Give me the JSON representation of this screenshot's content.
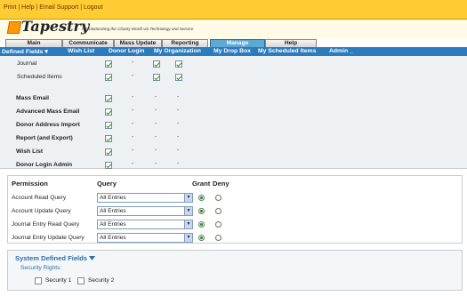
{
  "top_links": {
    "print": "Print",
    "help": "Help",
    "email_support": "Email Support",
    "logout": "Logout",
    "sep": "|"
  },
  "brand": {
    "name": "Tapestry",
    "tagline": "Revolutionizing the Charity World via Technology and Service"
  },
  "tabs": [
    {
      "label": "Main"
    },
    {
      "label": "Communicate"
    },
    {
      "label": "Mass Update"
    },
    {
      "label": "Reporting"
    },
    {
      "label": "Manage"
    },
    {
      "label": "Help"
    }
  ],
  "subnav": [
    "Defined Fields",
    "Wish List",
    "Donor Login",
    "My Organization",
    "My Drop Box",
    "My Scheduled Items",
    "Admin"
  ],
  "subnav_dropdown_marker": "▾",
  "subnav_admin_marker": "_",
  "feature_rows": [
    {
      "label": "Journal",
      "bold": false,
      "cells": [
        "check",
        "-",
        "check",
        "check"
      ]
    },
    {
      "label": "Scheduled Items",
      "bold": false,
      "cells": [
        "check",
        "-",
        "check",
        "check"
      ]
    },
    {
      "label": "Mass Email",
      "bold": true,
      "cells": [
        "check",
        "-",
        "-",
        "-"
      ]
    },
    {
      "label": "Advanced Mass Email",
      "bold": true,
      "cells": [
        "check",
        "-",
        "-",
        "-"
      ]
    },
    {
      "label": "Donor Address Import",
      "bold": true,
      "cells": [
        "check",
        "-",
        "-",
        "-"
      ]
    },
    {
      "label": "Report (and Export)",
      "bold": true,
      "cells": [
        "check",
        "-",
        "-",
        "-"
      ]
    },
    {
      "label": "Wish List",
      "bold": true,
      "cells": [
        "check",
        "-",
        "-",
        "-"
      ]
    },
    {
      "label": "Donor Login Admin",
      "bold": true,
      "cells": [
        "check",
        "-",
        "-",
        "-"
      ]
    }
  ],
  "permissions": {
    "headers": {
      "permission": "Permission",
      "query": "Query",
      "grant": "Grant",
      "deny": "Deny"
    },
    "rows": [
      {
        "label": "Account Read Query",
        "query": "All Entries",
        "grant": true
      },
      {
        "label": "Account Update Query",
        "query": "All Entries",
        "grant": true
      },
      {
        "label": "Journal Entry Read Query",
        "query": "All Entries",
        "grant": true
      },
      {
        "label": "Journal Entry Update Query",
        "query": "All Entries",
        "grant": true
      }
    ]
  },
  "system_fields": {
    "title": "System Defined Fields",
    "toggle_icon": "chevron-down-icon",
    "security_rights_label": "Security Rights:",
    "options": [
      {
        "label": "Security 1",
        "checked": false
      },
      {
        "label": "Security 2",
        "checked": false
      }
    ]
  },
  "colors": {
    "top_bar": "#ffcc33",
    "subnav": "#2b7bbd",
    "active_tab": "#5da9d6",
    "check": "#2a8a2a"
  }
}
